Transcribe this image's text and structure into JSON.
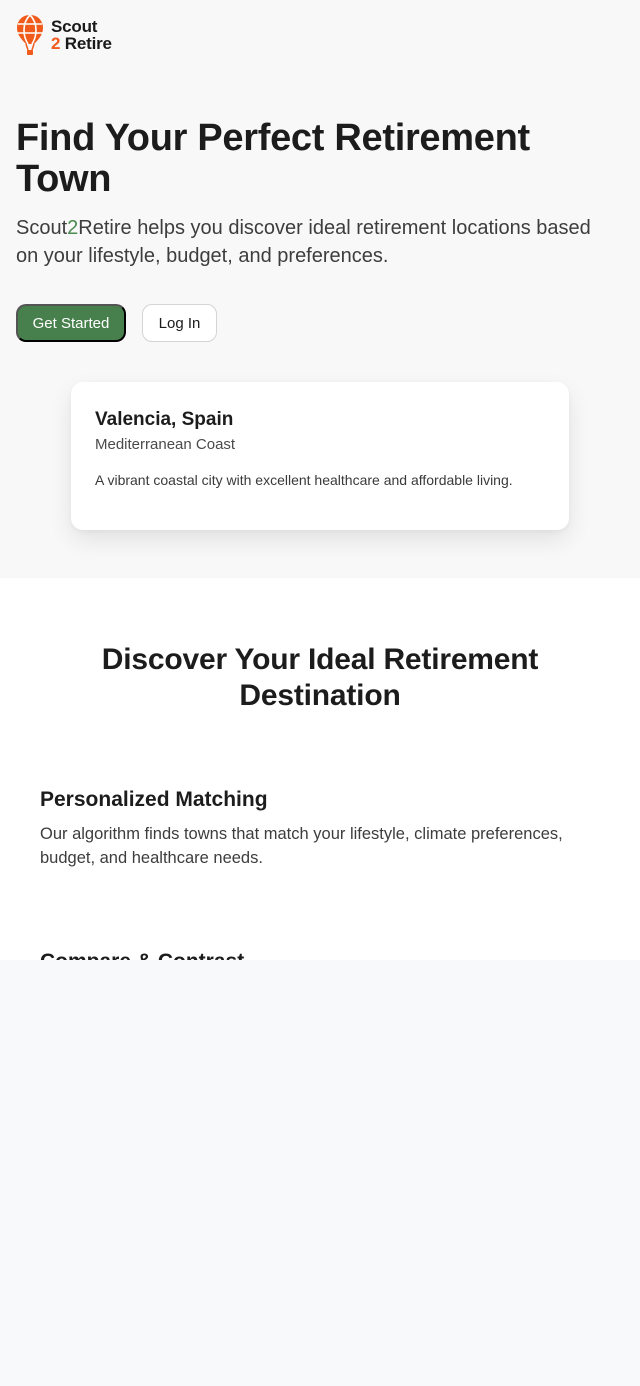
{
  "logo": {
    "line1": "Scout",
    "line2_number": "2",
    "line2_word": "Retire",
    "icon": "hot-air-balloon-icon",
    "icon_color": "#f05a1a"
  },
  "hero": {
    "title": "Find Your Perfect Retirement Town",
    "subtitle_brand_start": "Scout",
    "subtitle_brand_accent": "2",
    "subtitle_rest": "Retire helps you discover ideal retirement locations based on your lifestyle, budget, and preferences.",
    "primary_button": "Get Started",
    "secondary_button": "Log In"
  },
  "card": {
    "title": "Valencia, Spain",
    "region": "Mediterranean Coast",
    "description": "A vibrant coastal city with excellent healthcare and affordable living."
  },
  "features": {
    "heading": "Discover Your Ideal Retirement Destination",
    "items": [
      {
        "title": "Personalized Matching",
        "description": "Our algorithm finds towns that match your lifestyle, climate preferences, budget, and healthcare needs."
      },
      {
        "title": "Compare & Contrast"
      }
    ]
  },
  "colors": {
    "accent_green": "#47804c",
    "brand_orange": "#f05a1a"
  }
}
